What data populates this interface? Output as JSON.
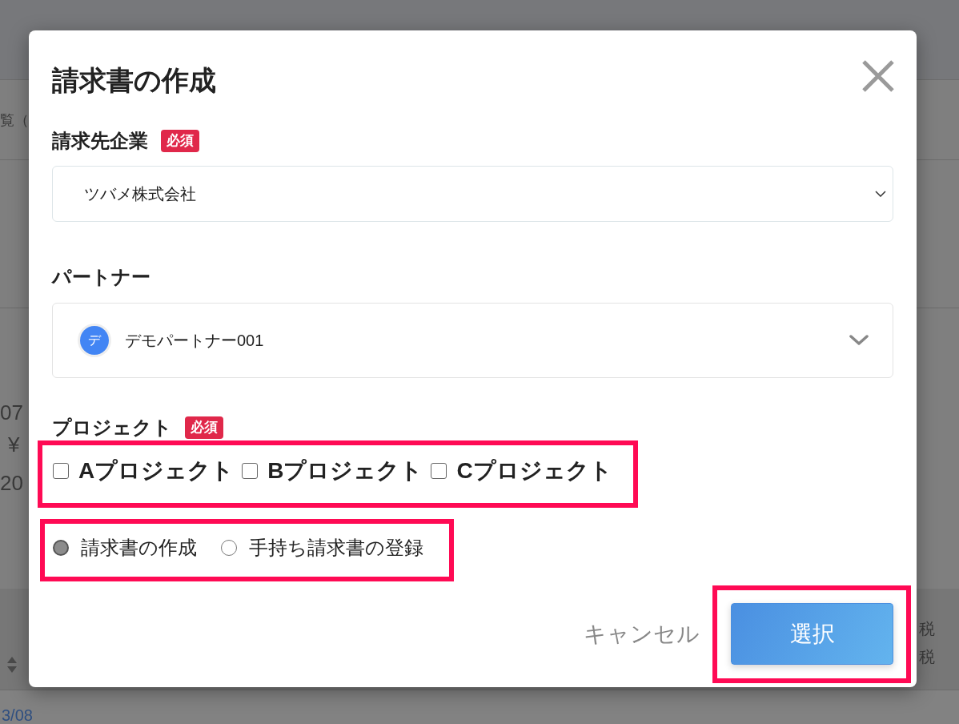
{
  "background_page": {
    "heading_fragment": "覧（",
    "value_fragments": [
      "07",
      "¥",
      "20"
    ],
    "column_header_fragments": [
      "税",
      "税"
    ],
    "link_fragment": "3/08"
  },
  "dialog": {
    "title": "請求書の作成",
    "fields": [
      {
        "kind": "select",
        "label": "請求先企業",
        "badge": "必須",
        "value": "ツバメ株式会社"
      },
      {
        "kind": "avatar_select",
        "label": "パートナー",
        "avatar": "デ",
        "value": "デモパートナー001"
      }
    ],
    "projects": {
      "label": "プロジェクト",
      "badge": "必須",
      "highlighted": true,
      "options": [
        {
          "label": "Aプロジェクト",
          "checked": false
        },
        {
          "label": "Bプロジェクト",
          "checked": false
        },
        {
          "label": "Cプロジェクト",
          "checked": false
        }
      ]
    },
    "invoice_type": {
      "highlighted": true,
      "options": [
        {
          "label": "請求書の作成",
          "selected": true
        },
        {
          "label": "手持ち請求書の登録",
          "selected": false
        }
      ]
    },
    "footer": {
      "cancel": "キャンセル",
      "submit": "選択",
      "submit_highlighted": true
    }
  }
}
